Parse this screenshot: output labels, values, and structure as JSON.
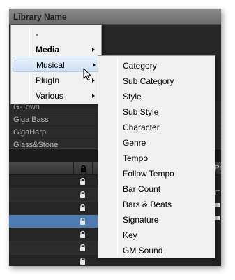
{
  "header": {
    "title": "Library Name"
  },
  "library_items": [
    "G-Town",
    "Giga Bass",
    "GigaHarp",
    "Glass&Stone"
  ],
  "context_menu": {
    "items": [
      {
        "label": "-",
        "bold": false,
        "has_submenu": false
      },
      {
        "label": "Media",
        "bold": true,
        "has_submenu": true
      },
      {
        "label": "Musical",
        "bold": false,
        "has_submenu": true,
        "highlighted": true
      },
      {
        "label": "PlugIn",
        "bold": false,
        "has_submenu": true
      },
      {
        "label": "Various",
        "bold": false,
        "has_submenu": true
      }
    ]
  },
  "submenu": {
    "items": [
      "Category",
      "Sub Category",
      "Style",
      "Sub Style",
      "Character",
      "Genre",
      "Tempo",
      "Follow Tempo",
      "Bar Count",
      "Bars & Beats",
      "Signature",
      "Key",
      "GM Sound"
    ]
  },
  "grid": {
    "side_header": "Pr",
    "selected_row": 3,
    "row_count": 7
  },
  "icons": {
    "lock": "lock-icon",
    "cursor": "mouse-pointer-icon",
    "submenu_arrow": "chevron-right-icon"
  },
  "colors": {
    "selection": "#4f7cb0",
    "menu_highlight": "#cfe1f5",
    "menu_bg": "#f0f0f0"
  }
}
